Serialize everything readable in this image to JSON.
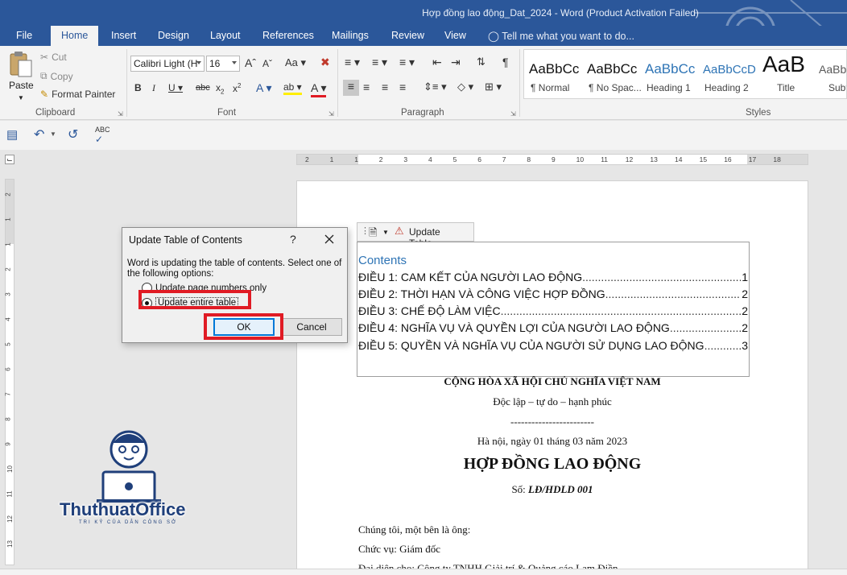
{
  "window": {
    "title": "Hợp đồng lao động_Dat_2024 - Word (Product Activation Failed)"
  },
  "tabs": [
    "File",
    "Home",
    "Insert",
    "Design",
    "Layout",
    "References",
    "Mailings",
    "Review",
    "View"
  ],
  "tell_me": "Tell me what you want to do...",
  "clipboard": {
    "paste": "Paste",
    "cut": "Cut",
    "copy": "Copy",
    "format_painter": "Format Painter",
    "label": "Clipboard"
  },
  "font": {
    "name": "Calibri Light (H",
    "size": "16",
    "label": "Font"
  },
  "paragraph": {
    "label": "Paragraph"
  },
  "styles": {
    "label": "Styles",
    "items": [
      {
        "preview": "AaBbCc",
        "name": "¶ Normal"
      },
      {
        "preview": "AaBbCc",
        "name": "¶ No Spac..."
      },
      {
        "preview": "AaBbCc",
        "name": "Heading 1"
      },
      {
        "preview": "AaBbCcD",
        "name": "Heading 2"
      },
      {
        "preview": "AaB",
        "name": "Title"
      },
      {
        "preview": "AaBb",
        "name": "Subt"
      }
    ]
  },
  "ruler": {
    "ticks": [
      "2",
      "1",
      "1",
      "2",
      "3",
      "4",
      "5",
      "6",
      "7",
      "8",
      "9",
      "10",
      "11",
      "12",
      "13",
      "14",
      "15",
      "16",
      "17",
      "18"
    ]
  },
  "vruler": {
    "ticks": [
      "2",
      "1",
      "1",
      "2",
      "3",
      "4",
      "5",
      "6",
      "7",
      "8",
      "9",
      "10",
      "11",
      "12",
      "13"
    ]
  },
  "toc": {
    "toolbar_label": "Update Table...",
    "heading": "Contents",
    "entries": [
      {
        "text": "ĐIỀU 1: CAM KẾT CỦA NGƯỜI LAO ĐỘNG",
        "page": "1"
      },
      {
        "text": "ĐIỀU 2: THỜI HẠN VÀ CÔNG VIỆC HỢP ĐỒNG ",
        "page": "2"
      },
      {
        "text": "ĐIỀU 3: CHẾ ĐỘ LÀM VIỆC ",
        "page": "2"
      },
      {
        "text": "ĐIỀU 4: NGHĨA VỤ VÀ QUYỀN LỢI CỦA NGƯỜI LAO ĐỘNG",
        "page": "2"
      },
      {
        "text": "ĐIỀU 5: QUYỀN VÀ NGHĨA VỤ CỦA NGƯỜI SỬ DỤNG LAO ĐỘNG",
        "page": "3"
      }
    ]
  },
  "document": {
    "nation": "CỘNG HÒA XÃ HỘI CHỦ NGHĨA VIỆT NAM",
    "motto": "Độc lập – tự do – hạnh phúc",
    "divider": "------------------------",
    "date": "Hà nội, ngày 01 tháng 03 năm 2023",
    "contract_title": "HỢP ĐỒNG LAO ĐỘNG",
    "number_label": "Số: ",
    "number_value": "LĐ/HDLD 001",
    "party_intro": "Chúng tôi, một bên là ông:",
    "position": "Chức vụ: Giám đốc",
    "representative": "Đại diện cho: Công ty TNHH Giải trí & Quảng cáo Lam Điền"
  },
  "dialog": {
    "title": "Update Table of Contents",
    "help": "?",
    "message": "Word is updating the table of contents.  Select one of the following options:",
    "option_page_numbers": "Update page numbers only",
    "option_entire": "Update entire table",
    "selected": "entire",
    "ok": "OK",
    "cancel": "Cancel"
  },
  "watermark": {
    "brand": "ThuthuatOffice",
    "tagline": "TRI KỶ CỦA DÂN CÔNG SỞ"
  },
  "colors": {
    "accent": "#2b579a",
    "highlight_box": "#e01b24",
    "toc_heading": "#2e74b5"
  }
}
